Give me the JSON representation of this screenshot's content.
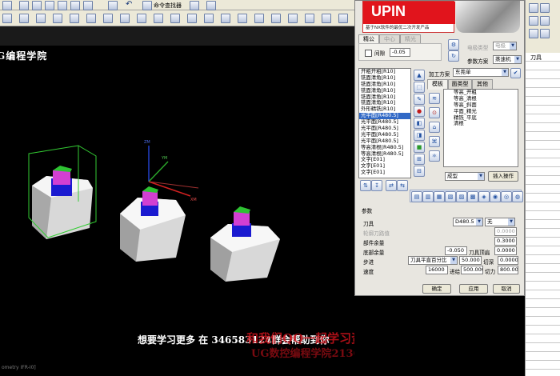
{
  "toolbar": {
    "command_finder_label": "命令查找器"
  },
  "viewport": {
    "watermark": "G编程学院",
    "status_text": "ometry IFR-I0]",
    "axis_labels": {
      "zm": "ZM",
      "ym": "YM",
      "xm": "XM"
    }
  },
  "banner": {
    "brand": "UPIN",
    "tagline": "基于NX软件的最优二次开发产品"
  },
  "right_tabs": [
    "精公",
    "中心",
    "精光"
  ],
  "gap": {
    "checkbox_label": "间隙",
    "value": "-0.05"
  },
  "file_type": {
    "label": "电极类型",
    "value": "电极"
  },
  "param_scheme": {
    "label": "参数方案",
    "value": "蒸速机"
  },
  "process": {
    "label": "加工方案",
    "value": "东莞单",
    "list": [
      "开粗开粗[R10]",
      "铣面清角[R10]",
      "铣面清角[R10]",
      "铣面清角[R10]",
      "铣面清角[R10]",
      "铣面清角[R10]",
      "外形精铣[R10]",
      "光平面[R480.5]",
      "光平面[R480.5]",
      "光平面[R480.5]",
      "光平面[R480.5]",
      "光平面[R480.5]",
      "等高清根[R480.5]",
      "等高清根[R480.5]",
      "文字[E01]",
      "文字[E01]",
      "文字[E01]"
    ],
    "selected_index": 7
  },
  "template_tabs": [
    "模板",
    "面类型",
    "其他"
  ],
  "template_list": [
    "等高_开粗",
    "等高_清根",
    "等高_斜面",
    "平面_精光",
    "精铣_平底",
    "清根"
  ],
  "insert": {
    "combo_value": "成型",
    "button_label": "插入操作"
  },
  "params": {
    "section_label": "参数",
    "tool_label": "刀具",
    "tool_value": "D480.5",
    "tool_type": "无",
    "tool_path_label": "轮廓刀路值",
    "tool_path_value": "0.0000",
    "wall_stock_label": "部件余量",
    "wall_stock_value": "0.3000",
    "floor_stock_label": "底部余量",
    "floor_stock_value": "-0.050",
    "tool_stock_label": "刀具顶扁",
    "tool_stock_value": "0.0000",
    "stepover_label": "步进",
    "stepover_type": "刀具平直百分比",
    "stepover_value": "50.000",
    "cut_label": "切深",
    "cut_value": "0.0000",
    "speed_label": "速度",
    "speed_value": "16000",
    "feed_label": "进给",
    "feed_value": "500.000",
    "plunge_label": "切力",
    "plunge_value": "800.000"
  },
  "buttons": {
    "ok": "确定",
    "apply": "应用",
    "cancel": "取消"
  },
  "right_grid": {
    "header": "刀具"
  },
  "subtitle": "想要学习更多 在 346583124群会帮助到你",
  "ad_text": "和我们QQ一起学习资料可以加QQ:2136836",
  "ad_text_2": "UG数控编程学院2136836"
}
